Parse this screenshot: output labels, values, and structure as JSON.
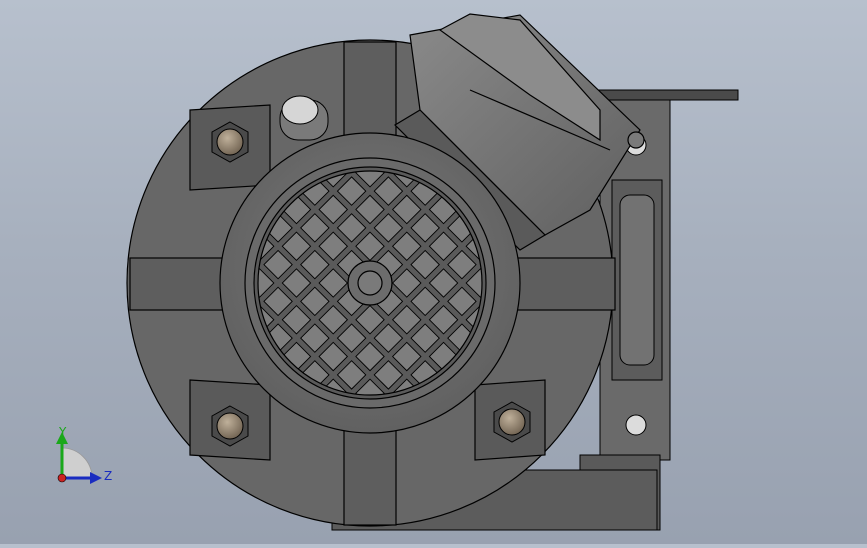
{
  "app": {
    "view": "front",
    "model": "motor-assembly"
  },
  "colors": {
    "background_top": "#b7c0cd",
    "background_bottom": "#98a1b0",
    "body_gray": "#6e6e6e",
    "body_dark": "#5a5a5a",
    "outline": "#000000",
    "nut_bronze": "#8a7a66",
    "axis_y": "#1aa81a",
    "axis_z": "#1a2cc0",
    "origin": "#cc2222"
  },
  "triad": {
    "y_label": "Y",
    "z_label": "Z",
    "icon": "axis-triad-icon"
  }
}
